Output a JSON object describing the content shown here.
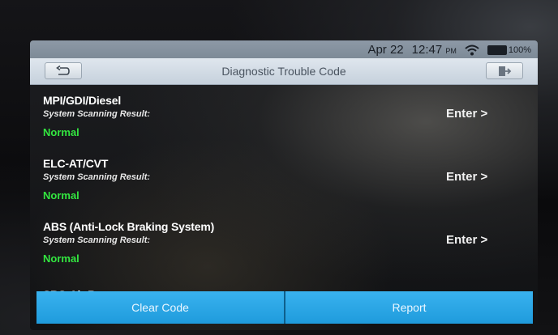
{
  "status_bar": {
    "date": "Apr 22",
    "time": "12:47",
    "ampm": "PM",
    "battery": "100%",
    "battery_color": "#29d93a"
  },
  "header": {
    "title": "Diagnostic Trouble Code",
    "back_icon": "back-arrow-icon",
    "exit_icon": "exit-icon"
  },
  "systems": [
    {
      "name": "MPI/GDI/Diesel",
      "subtitle": "System Scanning Result:",
      "status": "Normal",
      "action": "Enter >"
    },
    {
      "name": "ELC-AT/CVT",
      "subtitle": "System Scanning Result:",
      "status": "Normal",
      "action": "Enter >"
    },
    {
      "name": "ABS (Anti-Lock Braking System)",
      "subtitle": "System Scanning Result:",
      "status": "Normal",
      "action": "Enter >"
    },
    {
      "name": "SRS-Air Bag"
    }
  ],
  "footer": {
    "clear_label": "Clear Code",
    "report_label": "Report"
  },
  "colors": {
    "status_normal": "#33e640",
    "button_blue": "#2aa6e6"
  }
}
